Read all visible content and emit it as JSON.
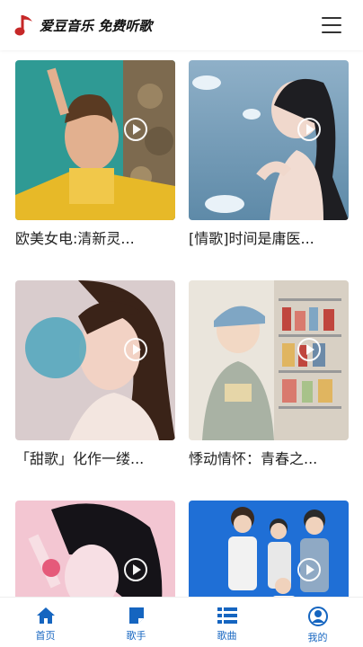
{
  "header": {
    "logo_text": "爱豆音乐 免费听歌",
    "logo_icon": "music-note-icon",
    "menu_icon": "hamburger-menu-icon"
  },
  "playlists": [
    {
      "title": "欧美女电:清新灵..."
    },
    {
      "title": "[情歌]时间是庸医..."
    },
    {
      "title": "「甜歌」化作一缕..."
    },
    {
      "title": "悸动情怀：青春之..."
    },
    {
      "title": ""
    },
    {
      "title": ""
    }
  ],
  "tabbar": {
    "items": [
      {
        "label": "首页",
        "icon": "home-icon"
      },
      {
        "label": "歌手",
        "icon": "singer-icon"
      },
      {
        "label": "歌曲",
        "icon": "song-list-icon"
      },
      {
        "label": "我的",
        "icon": "user-icon"
      }
    ]
  },
  "colors": {
    "accent": "#1565c0",
    "logo_red": "#c62828"
  }
}
